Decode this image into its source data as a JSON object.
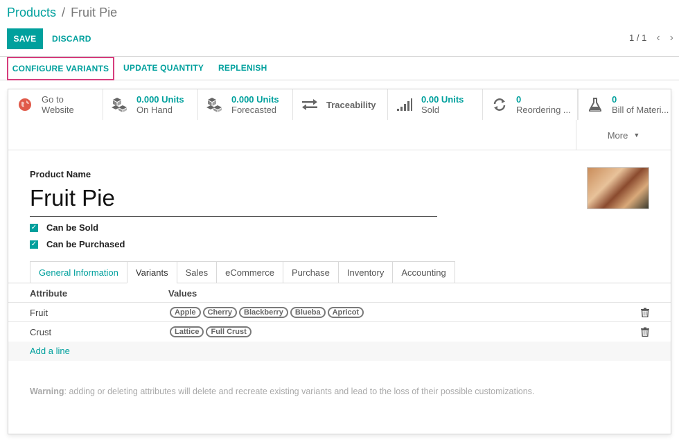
{
  "breadcrumb": {
    "parent": "Products",
    "separator": "/",
    "current": "Fruit Pie"
  },
  "control": {
    "save": "SAVE",
    "discard": "DISCARD",
    "pager": "1 / 1",
    "prev_icon": "chevron-left-icon",
    "next_icon": "chevron-right-icon"
  },
  "actions": {
    "configure_variants": "CONFIGURE VARIANTS",
    "update_quantity": "UPDATE QUANTITY",
    "replenish": "REPLENISH"
  },
  "stat_buttons": {
    "website": {
      "line1": "Go to",
      "line2": "Website",
      "icon": "globe-icon"
    },
    "on_hand": {
      "value": "0.000 Units",
      "label": "On Hand",
      "icon": "cubes-icon"
    },
    "forecasted": {
      "value": "0.000 Units",
      "label": "Forecasted",
      "icon": "cubes-icon"
    },
    "traceability": {
      "label": "Traceability",
      "icon": "exchange-arrows-icon"
    },
    "sold": {
      "value": "0.00 Units",
      "label": "Sold",
      "icon": "signal-bars-icon"
    },
    "reordering": {
      "value": "0",
      "label": "Reordering ...",
      "icon": "refresh-icon"
    },
    "bom": {
      "value": "0",
      "label": "Bill of Materi...",
      "icon": "flask-icon"
    },
    "more": "More"
  },
  "form": {
    "product_name_label": "Product Name",
    "product_name": "Fruit Pie",
    "can_be_sold": "Can be Sold",
    "can_be_purchased": "Can be Purchased"
  },
  "tabs": [
    "General Information",
    "Variants",
    "Sales",
    "eCommerce",
    "Purchase",
    "Inventory",
    "Accounting"
  ],
  "variants": {
    "header_attribute": "Attribute",
    "header_values": "Values",
    "rows": [
      {
        "attribute": "Fruit",
        "values": [
          "Apple",
          "Cherry",
          "Blackberry",
          "Blueba",
          "Apricot"
        ]
      },
      {
        "attribute": "Crust",
        "values": [
          "Lattice",
          "Full Crust"
        ]
      }
    ],
    "add_line": "Add a line",
    "warning_label": "Warning",
    "warning_text": ": adding or deleting attributes will delete and recreate existing variants and lead to the loss of their possible customizations."
  },
  "colors": {
    "accent": "#00a09d",
    "highlight_border": "#d63d7d",
    "website_icon": "#e05a4a"
  }
}
